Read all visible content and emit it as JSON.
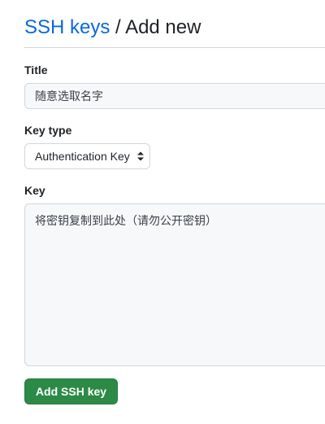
{
  "breadcrumb": {
    "link": "SSH keys",
    "separator": "/",
    "current": "Add new"
  },
  "form": {
    "title_label": "Title",
    "title_placeholder": "随意选取名字",
    "key_type_label": "Key type",
    "key_type_selected": "Authentication Key",
    "key_label": "Key",
    "key_placeholder": "将密钥复制到此处（请勿公开密钥）",
    "submit_label": "Add SSH key"
  },
  "colors": {
    "link": "#0969da",
    "primary_button": "#2c8a47",
    "input_background": "#f6f8fa",
    "border": "#d0d7de"
  }
}
